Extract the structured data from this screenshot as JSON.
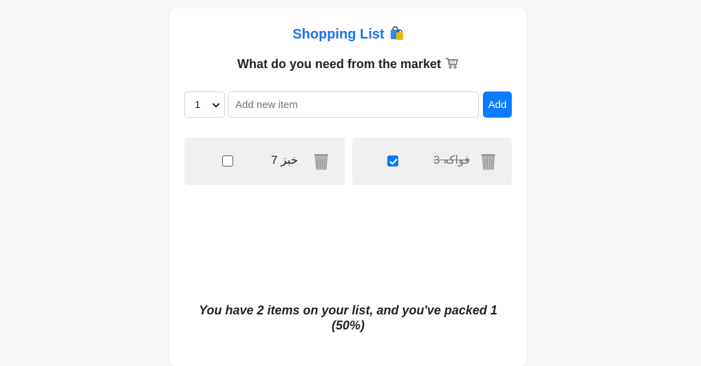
{
  "header": {
    "title": "Shopping List",
    "title_icon": "shopping-bags-icon",
    "subtitle": "What do you need from the market",
    "subtitle_icon": "shopping-cart-icon"
  },
  "form": {
    "quantity_selected": "1",
    "item_placeholder": "Add new item",
    "item_value": "",
    "add_label": "Add"
  },
  "items": [
    {
      "text": "خبز 7",
      "packed": false
    },
    {
      "text": "فواكه 3",
      "packed": true
    }
  ],
  "summary": "You have 2 items on your list, and you've packed 1 (50%)",
  "colors": {
    "accent": "#0a7cff",
    "title": "#1a73e8",
    "item_bg": "#efefef",
    "page_bg": "#f6f7f9"
  }
}
